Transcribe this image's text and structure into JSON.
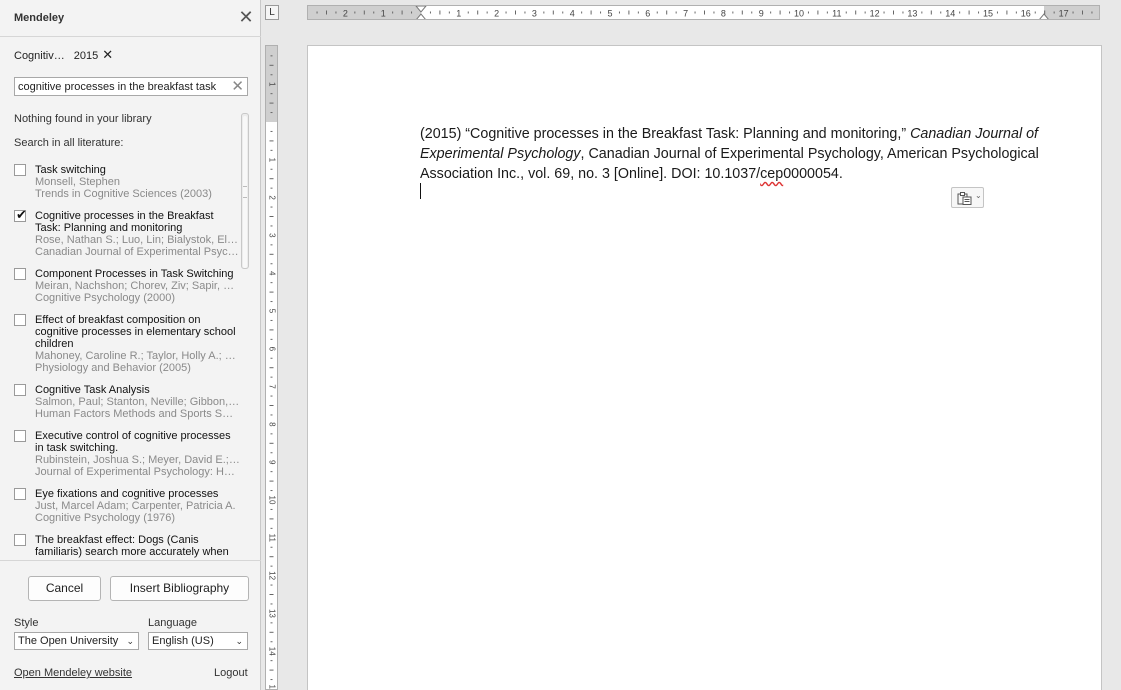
{
  "panel": {
    "title": "Mendeley",
    "filter_chip": {
      "label": "Cognitiv…",
      "year": "2015"
    },
    "search_value": "cognitive processes in the breakfast task",
    "nothing_found": "Nothing found in your library",
    "search_all_label": "Search in all literature:",
    "results": [
      {
        "title": "Task switching",
        "authors": "Monsell, Stephen",
        "source": "Trends in Cognitive Sciences (2003)",
        "checked": false
      },
      {
        "title": "Cognitive processes in the Breakfast Task: Planning and monitoring",
        "authors": "Rose, Nathan S.; Luo, Lin; Bialystok, El…",
        "source": "Canadian Journal of Experimental Psyc…",
        "checked": true
      },
      {
        "title": "Component Processes in Task Switching",
        "authors": "Meiran, Nachshon; Chorev, Ziv; Sapir, …",
        "source": "Cognitive Psychology (2000)",
        "checked": false
      },
      {
        "title": "Effect of breakfast composition on cognitive processes in elementary school children",
        "authors": "Mahoney, Caroline R.; Taylor, Holly A.; …",
        "source": "Physiology and Behavior (2005)",
        "checked": false
      },
      {
        "title": "Cognitive Task Analysis",
        "authors": "Salmon, Paul; Stanton, Neville; Gibbon,…",
        "source": "Human Factors Methods and Sports S…",
        "checked": false
      },
      {
        "title": "Executive control of cognitive processes in task switching.",
        "authors": "Rubinstein, Joshua S.; Meyer, David E.;…",
        "source": "Journal of Experimental Psychology: H…",
        "checked": false
      },
      {
        "title": "Eye fixations and cognitive processes",
        "authors": "Just, Marcel Adam; Carpenter, Patricia A.",
        "source": "Cognitive Psychology (1976)",
        "checked": false
      },
      {
        "title": "The breakfast effect: Dogs (Canis familiaris) search more accurately when they are less hungry",
        "authors": "",
        "source": "",
        "checked": false
      }
    ],
    "cancel_label": "Cancel",
    "insert_label": "Insert Bibliography",
    "style_label": "Style",
    "style_value": "The Open University",
    "language_label": "Language",
    "language_value": "English (US)",
    "website_link": "Open Mendeley website",
    "logout_label": "Logout"
  },
  "ruler": {
    "h_numbers": [
      "2",
      "1",
      "1",
      "1",
      "2",
      "3",
      "4",
      "5",
      "6",
      "7",
      "8",
      "9",
      "10",
      "11",
      "12",
      "13",
      "14",
      "15",
      "16",
      "17"
    ],
    "v_numbers": [
      "1",
      "1",
      "2",
      "3",
      "4",
      "5",
      "6",
      "7",
      "8",
      "9",
      "10",
      "11",
      "12",
      "13",
      "14",
      "15"
    ],
    "tab_glyph": "L"
  },
  "document": {
    "citation_prefix": "(2015) “Cognitive processes in the Breakfast Task: Planning and monitoring,” ",
    "citation_journal_italic": "Canadian Journal of Experimental Psychology",
    "citation_middle": ", Canadian Journal of Experimental Psychology, American Psychological Association Inc., vol. 69, no. 3 [Online]. DOI: 10.1037/",
    "citation_doi_flagged": "cep",
    "citation_suffix": "0000054."
  },
  "icons": {
    "close": "close-icon",
    "clear": "clear-search-icon",
    "paste": "paste-options-icon"
  }
}
